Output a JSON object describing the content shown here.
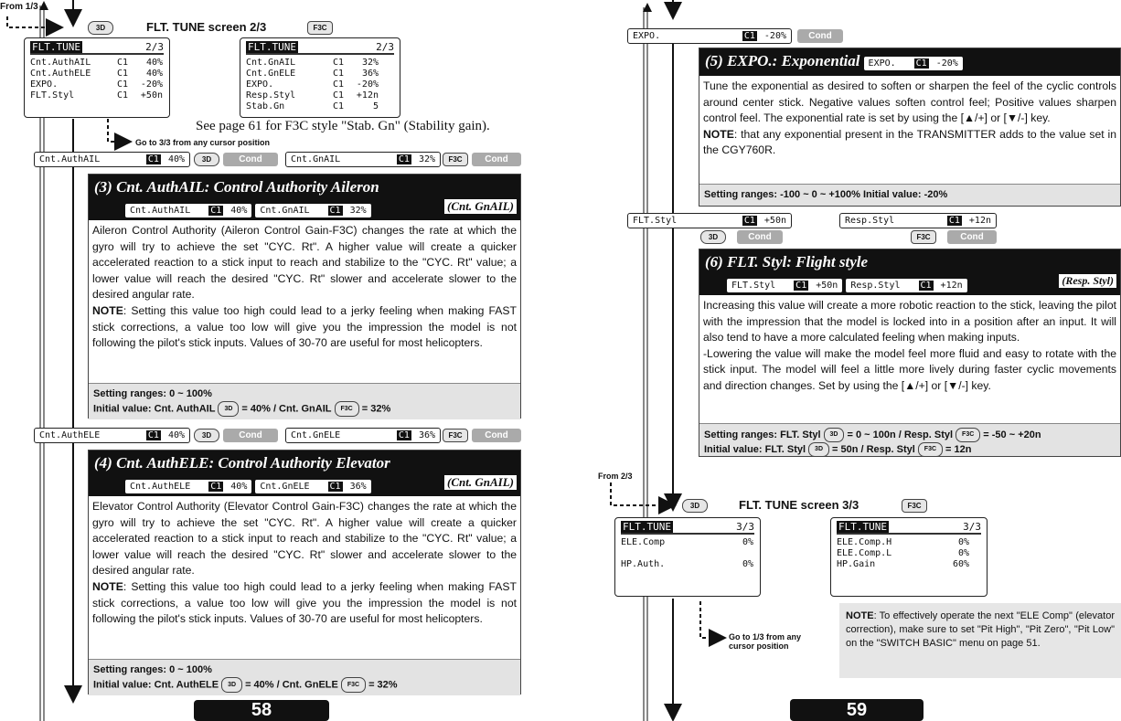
{
  "left": {
    "from": "From 1/3",
    "screen_title": "FLT. TUNE screen 2/3",
    "badge_3d": "3D",
    "badge_f3c": "F3C",
    "lcd_3d": {
      "title": "FLT.TUNE",
      "page": "2/3",
      "rows": [
        [
          "Cnt.AuthAIL",
          "C1",
          "40%"
        ],
        [
          "Cnt.AuthELE",
          "C1",
          "40%"
        ],
        [
          "EXPO.",
          "C1",
          "-20%"
        ],
        [
          "FLT.Styl",
          "C1",
          "+50n"
        ]
      ]
    },
    "lcd_f3c": {
      "title": "FLT.TUNE",
      "page": "2/3",
      "rows": [
        [
          "Cnt.GnAIL",
          "C1",
          "32%"
        ],
        [
          "Cnt.GnELE",
          "C1",
          "36%"
        ],
        [
          "EXPO.",
          "C1",
          "-20%"
        ],
        [
          "Resp.Styl",
          "C1",
          "+12n"
        ],
        [
          "Stab.Gn",
          "C1",
          "5"
        ]
      ]
    },
    "see_note": "See page 61 for F3C style \"Stab. Gn\" (Stability gain).",
    "goto": "Go to 3/3 from any cursor position",
    "cond": "Cond",
    "c1": "C1",
    "s3": {
      "strip_a": "Cnt.AuthAIL",
      "val_a": "40%",
      "strip_b": "Cnt.GnAIL",
      "val_b": "32%",
      "title": "(3) Cnt. AuthAIL: Control Authority Aileron",
      "alt": "(Cnt. GnAIL)",
      "body": "Aileron Control Authority (Aileron Control Gain-F3C) changes the rate at which the gyro will try to achieve the set \"CYC. Rt\". A higher value will create a quicker accelerated reaction to a stick input to reach and stabilize to the \"CYC. Rt\" value; a lower value will reach the desired \"CYC. Rt\" slower and accelerate slower to the desired angular rate.",
      "note_label": "NOTE",
      "note": ": Setting this value too high could lead to a jerky feeling when making FAST stick corrections, a value too low will give you the impression the model is not following the pilot's stick inputs. Values of 30-70 are useful for most helicopters.",
      "range": "Setting ranges: 0 ~ 100%",
      "init_a": "Initial value: Cnt. AuthAIL",
      "init_b": "= 40% / Cnt. GnAIL",
      "init_c": "= 32%"
    },
    "s4": {
      "strip_a": "Cnt.AuthELE",
      "val_a": "40%",
      "strip_b": "Cnt.GnELE",
      "val_b": "36%",
      "title": "(4) Cnt. AuthELE: Control Authority Elevator",
      "alt": "(Cnt. GnAIL)",
      "body": "Elevator Control Authority (Elevator Control Gain-F3C) changes the rate at which the gyro will try to achieve the set \"CYC. Rt\". A higher value will create a quicker accelerated reaction to a stick input to reach and stabilize to the \"CYC. Rt\" value; a lower value will reach the desired \"CYC. Rt\" slower and accelerate slower to the desired angular rate.",
      "note_label": "NOTE",
      "note": ": Setting this value too high could lead to a jerky feeling when making FAST stick corrections, a value too low will give you the impression the model is not following the pilot's stick inputs. Values of 30-70 are useful for most helicopters.",
      "range": "Setting ranges: 0 ~ 100%",
      "init_a": "Initial value: Cnt. AuthELE",
      "init_b": "= 40% / Cnt. GnELE",
      "init_c": "= 32%"
    },
    "page": "58"
  },
  "right": {
    "s5": {
      "strip": "EXPO.",
      "val": "-20%",
      "title": "(5) EXPO.: Exponential",
      "body": "Tune the exponential as desired to soften or sharpen the feel of the cyclic controls around center stick. Negative values soften control feel; Positive values sharpen control feel. The exponential rate is set by using the [▲/+] or [▼/-] key.",
      "note_label": "NOTE",
      "note": ": that any exponential present in the TRANSMITTER adds to the value set in the CGY760R.",
      "range": "Setting ranges: -100 ~ 0 ~ +100%    Initial value: -20%"
    },
    "s6": {
      "strip_a": "FLT.Styl",
      "val_a": "+50n",
      "strip_b": "Resp.Styl",
      "val_b": "+12n",
      "title": "(6) FLT. Styl: Flight style",
      "alt": "(Resp. Styl)",
      "body": "Increasing this value will create a more robotic reaction to the stick, leaving the pilot with the impression that the model is locked into in a position after an input. It will also tend to have a more calculated feeling when making inputs.",
      "body2": "-Lowering the value will make the model feel more fluid and easy to rotate with the stick input. The model will feel a little more lively during faster cyclic movements and direction changes. Set by using the [▲/+] or [▼/-] key.",
      "range_a": "Setting ranges: FLT. Styl",
      "range_b": "= 0 ~ 100n / Resp. Styl",
      "range_c": "=  -50 ~ +20n",
      "init_a": "Initial value: FLT. Styl",
      "init_b": "= 50n / Resp. Styl",
      "init_c": "= 12n"
    },
    "from": "From 2/3",
    "screen_title": "FLT. TUNE screen 3/3",
    "lcd_3d": {
      "title": "FLT.TUNE",
      "page": "3/3",
      "rows": [
        [
          "ELE.Comp",
          "",
          "0%"
        ],
        [
          "",
          "",
          " "
        ],
        [
          "HP.Auth.",
          "",
          "0%"
        ]
      ]
    },
    "lcd_f3c": {
      "title": "FLT.TUNE",
      "page": "3/3",
      "rows": [
        [
          "ELE.Comp.H",
          "",
          "0%"
        ],
        [
          "ELE.Comp.L",
          "",
          "0%"
        ],
        [
          "HP.Gain",
          "",
          "60%"
        ]
      ]
    },
    "goto": "Go to 1/3 from any cursor position",
    "note_label": "NOTE",
    "note": ": To effectively operate the next \"ELE Comp\" (elevator correction), make sure to set \"Pit High\", \"Pit Zero\", \"Pit Low\" on the \"SWITCH BASIC\" menu on page 51.",
    "page": "59"
  }
}
